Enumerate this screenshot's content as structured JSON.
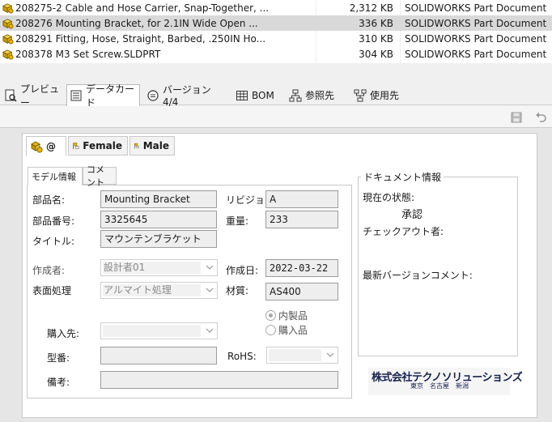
{
  "files": [
    {
      "name": "208275-2 Cable and Hose Carrier, Snap-Together, ...",
      "size": "2,312 KB",
      "type": "SOLIDWORKS Part Document",
      "selected": false
    },
    {
      "name": "208276 Mounting Bracket, for 2.1IN Wide Open ...",
      "size": "336 KB",
      "type": "SOLIDWORKS Part Document",
      "selected": true
    },
    {
      "name": "208291 Fitting, Hose, Straight, Barbed, .250IN Ho...",
      "size": "310 KB",
      "type": "SOLIDWORKS Part Document",
      "selected": false
    },
    {
      "name": "208378 M3 Set Screw.SLDPRT",
      "size": "304 KB",
      "type": "SOLIDWORKS Part Document",
      "selected": false
    }
  ],
  "tabs": {
    "preview": "プレビュー",
    "datacard": "データカード",
    "version": "バージョン 4/4",
    "bom": "BOM",
    "references": "参照先",
    "where_used": "使用先"
  },
  "config_tabs": {
    "default": "@",
    "female": "Female",
    "male": "Male"
  },
  "sub_tabs": {
    "model_info": "モデル情報",
    "comment": "コメント"
  },
  "form": {
    "part_name_label": "部品名:",
    "part_name": "Mounting Bracket",
    "revision_label": "リビジョン:",
    "revision": "A",
    "part_number_label": "部品番号:",
    "part_number": "3325645",
    "weight_label": "重量:",
    "weight": "233",
    "title_label": "タイトル:",
    "title": "マウンテンブラケット",
    "author_label": "作成者:",
    "author": "設計者01",
    "created_label": "作成日:",
    "created": "2022-03-22",
    "surface_label": "表面処理",
    "surface": "アルマイト処理",
    "material_label": "材質:",
    "material": "AS400",
    "radio_inhouse": "内製品",
    "radio_purchased": "購入品",
    "vendor_label": "購入先:",
    "model_label": "型番:",
    "rohs_label": "RoHS:",
    "notes_label": "備考:"
  },
  "doc_info": {
    "legend": "ドキュメント情報",
    "state_label": "現在の状態:",
    "state": "承認",
    "checkout_label": "チェックアウト者:",
    "latest_comment_label": "最新バージョンコメント:"
  },
  "logo": {
    "company": "株式会社テクノソリューションズ",
    "cities": "東京　名古屋　新潟"
  },
  "colors": {
    "part_icon": "#e8b400",
    "logo": "#16214f",
    "selected_row": "#d9d9d9"
  }
}
